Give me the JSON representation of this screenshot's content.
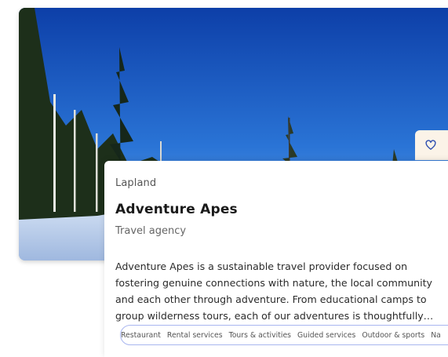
{
  "listing": {
    "region": "Lapland",
    "name": "Adventure Apes",
    "category": "Travel agency",
    "description": "Adventure Apes is a sustainable travel provider focused on fostering genuine connections with nature, the local community and each other through adventure. From educational camps to group wilderness tours, each of our adventures is thoughtfully…",
    "tags": [
      "Restaurant",
      "Rental services",
      "Tours & activities",
      "Guided services",
      "Outdoor & sports",
      "Na"
    ]
  },
  "icons": {
    "favorite": "heart-outline-icon"
  },
  "colors": {
    "heart": "#2f4fb0",
    "tag_border": "#a9b6f0",
    "favorite_bg": "#fbf3e8"
  }
}
